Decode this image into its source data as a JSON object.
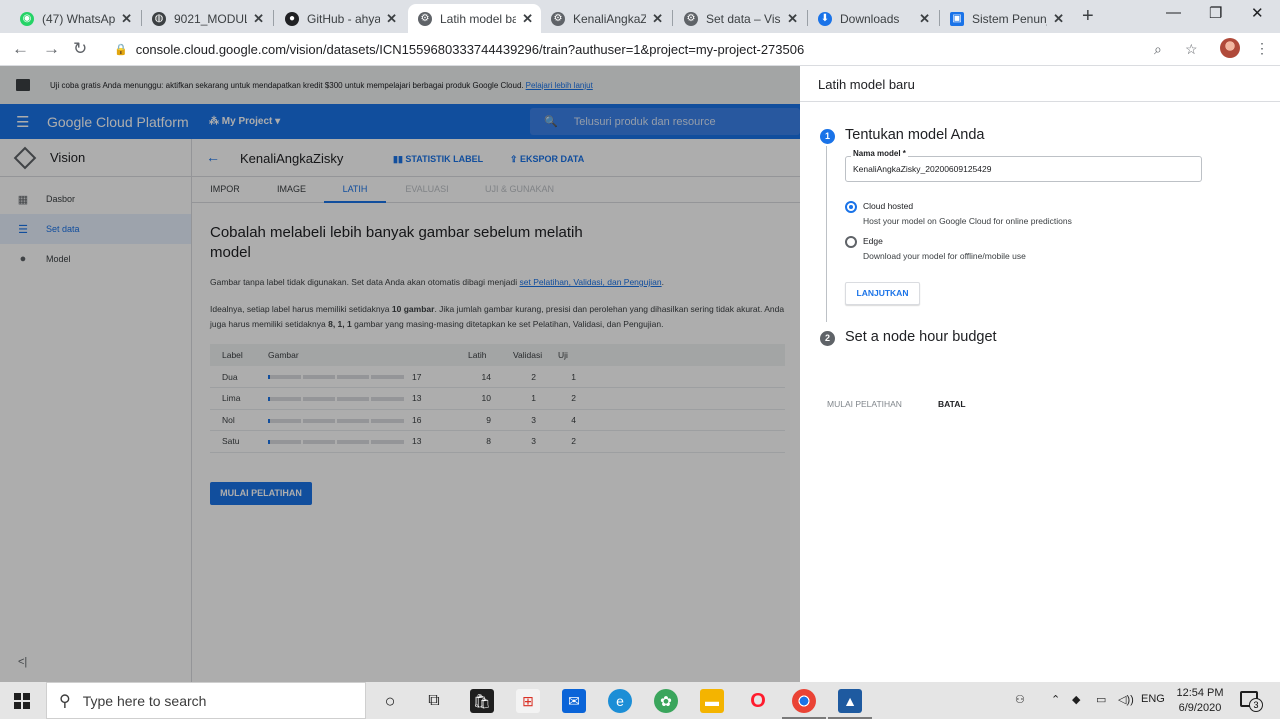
{
  "browser": {
    "tabs": [
      {
        "title": "(47) WhatsApp",
        "fav_color": "#25d366",
        "fav_glyph": "◉"
      },
      {
        "title": "9021_MODUL",
        "fav_color": "#3c4043",
        "fav_glyph": "◍"
      },
      {
        "title": "GitHub - ahya",
        "fav_color": "#202124",
        "fav_glyph": "●"
      },
      {
        "title": "Latih model ba",
        "fav_color": "#5f6368",
        "fav_glyph": "⚙"
      },
      {
        "title": "KenaliAngkaZi",
        "fav_color": "#5f6368",
        "fav_glyph": "⚙"
      },
      {
        "title": "Set data – Visi",
        "fav_color": "#5f6368",
        "fav_glyph": "⚙"
      },
      {
        "title": "Downloads",
        "fav_color": "#1a73e8",
        "fav_glyph": "⬇"
      },
      {
        "title": "Sistem Penunj",
        "fav_color": "#1a73e8",
        "fav_glyph": "▣"
      }
    ],
    "url": "console.cloud.google.com/vision/datasets/ICN1559680333744439296/train?authuser=1&project=my-project-273506"
  },
  "promo": {
    "text": "Uji coba gratis Anda menunggu: aktifkan sekarang untuk mendapatkan kredit $300 untuk mempelajari berbagai produk Google Cloud.",
    "link": "Pelajari lebih lanjut"
  },
  "gcp": {
    "brand": "Google Cloud Platform",
    "project": "My Project",
    "search_placeholder": "Telusuri produk dan resource"
  },
  "nav": {
    "product": "Vision",
    "items": [
      {
        "label": "Dasbor",
        "icon": "dashboard-icon"
      },
      {
        "label": "Set data",
        "icon": "list-icon"
      },
      {
        "label": "Model",
        "icon": "bulb-icon"
      }
    ]
  },
  "dataset": {
    "name": "KenaliAngkaZisky",
    "actions": [
      "STATISTIK LABEL",
      "EKSPOR DATA"
    ],
    "tabs": [
      "IMPOR",
      "IMAGE",
      "LATIH",
      "EVALUASI",
      "UJI & GUNAKAN"
    ]
  },
  "train": {
    "heading": "Cobalah melabeli lebih banyak gambar sebelum melatih model",
    "para1_prefix": "Gambar tanpa label tidak digunakan. Set data Anda akan otomatis dibagi menjadi ",
    "para1_link": "set Pelatihan, Validasi, dan Pengujian",
    "para1_suffix": ".",
    "para2_a": "Idealnya, setiap label harus memiliki setidaknya ",
    "para2_b": "10 gambar",
    "para2_c": ". Jika jumlah gambar kurang, presisi dan perolehan yang dihasilkan sering tidak akurat. Anda juga harus memiliki setidaknya ",
    "para2_d": "8, 1, 1",
    "para2_e": " gambar yang masing-masing ditetapkan ke set Pelatihan, Validasi, dan Pengujian.",
    "columns": [
      "Label",
      "Gambar",
      "Latih",
      "Validasi",
      "Uji"
    ],
    "rows": [
      {
        "label": "Dua",
        "images": "17",
        "train": "14",
        "val": "2",
        "test": "1"
      },
      {
        "label": "Lima",
        "images": "13",
        "train": "10",
        "val": "1",
        "test": "2"
      },
      {
        "label": "Nol",
        "images": "16",
        "train": "9",
        "val": "3",
        "test": "4"
      },
      {
        "label": "Satu",
        "images": "13",
        "train": "8",
        "val": "3",
        "test": "2"
      }
    ],
    "button": "MULAI PELATIHAN"
  },
  "panel": {
    "title": "Latih model baru",
    "step1": {
      "num": "1",
      "title": "Tentukan model Anda"
    },
    "name_label": "Nama model *",
    "name_value": "KenaliAngkaZisky_20200609125429",
    "options": [
      {
        "label": "Cloud hosted",
        "desc": "Host your model on Google Cloud for online predictions",
        "selected": true
      },
      {
        "label": "Edge",
        "desc": "Download your model for offline/mobile use",
        "selected": false
      }
    ],
    "next": "LANJUTKAN",
    "step2": {
      "num": "2",
      "title": "Set a node hour budget"
    },
    "start": "MULAI PELATIHAN",
    "cancel": "BATAL"
  },
  "taskbar": {
    "search_placeholder": "Type here to search",
    "lang": "ENG",
    "time": "12:54 PM",
    "date": "6/9/2020",
    "notif_count": "3"
  },
  "colors": {
    "accent": "#1a73e8",
    "step_active": "#1a73e8",
    "step_inactive": "#5f6368"
  }
}
